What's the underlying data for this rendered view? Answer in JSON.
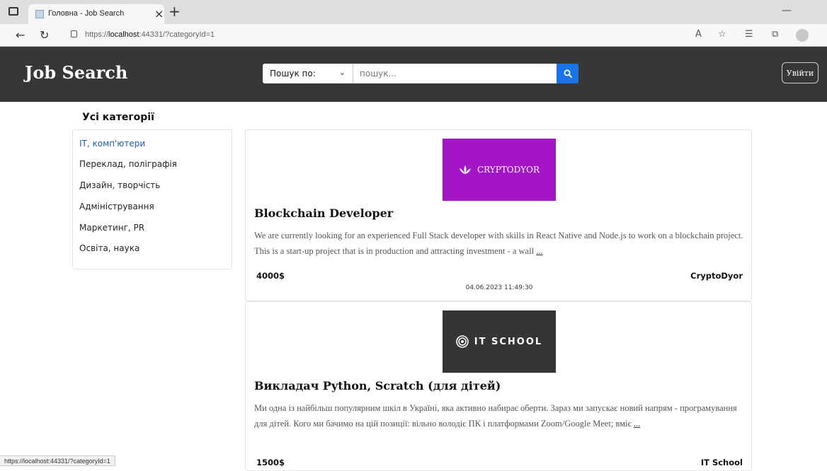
{
  "browser": {
    "tab_title": "Головна - Job Search",
    "url_prefix": "https://",
    "url_host": "localhost",
    "url_rest": ":44331/?categoryId=1",
    "status_url": "https://localhost:44331/?categoryId=1"
  },
  "header": {
    "brand": "Job Search",
    "search_by_label": "Пошук по:",
    "search_placeholder": "пошук...",
    "login_label": "Увійти",
    "background_color": "#373737",
    "accent_color": "#1a73e8"
  },
  "sidebar": {
    "title": "Усі категорії",
    "items": [
      {
        "label": "IT, комп'ютери",
        "active": true
      },
      {
        "label": "Переклад, поліграфія",
        "active": false
      },
      {
        "label": "Дизайн, творчість",
        "active": false
      },
      {
        "label": "Адміністрування",
        "active": false
      },
      {
        "label": "Маркетинг, PR",
        "active": false
      },
      {
        "label": "Освіта, наука",
        "active": false
      }
    ]
  },
  "jobs": [
    {
      "logo_text": "CRYPTODYOR",
      "logo_bg": "#a415c8",
      "title": "Blockchain Developer",
      "description": "We are currently looking for an experienced Full Stack developer with skills in React Native and Node.js to work on a blockchain project. This is a start-up project that is in production and attracting investment - a wall",
      "more": "...",
      "salary": "4000$",
      "company": "CryptoDyor",
      "date": "04.06.2023 11:49:30"
    },
    {
      "logo_text": "IT SCHOOL",
      "logo_bg": "#353535",
      "title": "Викладач Python, Scratch (для дітей)",
      "description": "Ми одна із найбільш популярним шкіл в Україні, яка активно набирає оберти. Зараз ми запускає новий напрям - програмування для дітей. Кого ми бачимо на цій позиції: вільно володіє ПК і платформами Zoom/Google Meet; вміє",
      "more": "...",
      "salary": "1500$",
      "company": "IT School"
    }
  ]
}
